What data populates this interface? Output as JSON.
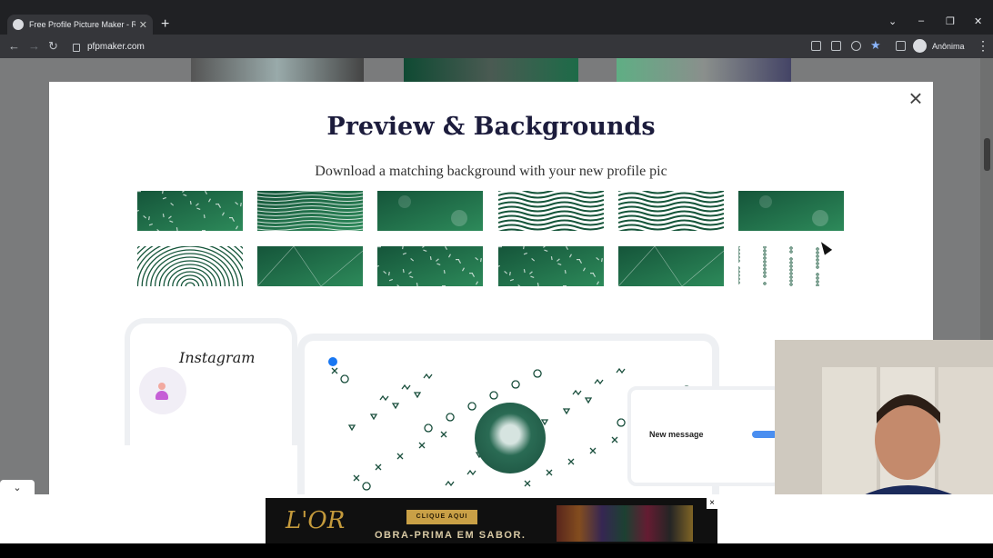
{
  "browser": {
    "tab_title": "Free Profile Picture Maker - Resu",
    "new_tab_symbol": "+",
    "url": "pfpmaker.com",
    "profile_label": "Anônima"
  },
  "modal": {
    "title": "Preview & Backgrounds",
    "subtitle": "Download a matching background with your new profile pic",
    "close_symbol": "×"
  },
  "backgrounds": [
    {
      "pattern": "confetti-lines"
    },
    {
      "pattern": "maze-swirl"
    },
    {
      "pattern": "gradient-shapes"
    },
    {
      "pattern": "star-rays"
    },
    {
      "pattern": "waves"
    },
    {
      "pattern": "bokeh-grid"
    },
    {
      "pattern": "concentric-rings"
    },
    {
      "pattern": "low-poly"
    },
    {
      "pattern": "wave-lines-shapes"
    },
    {
      "pattern": "doodle-shapes"
    },
    {
      "pattern": "dark-geometric"
    },
    {
      "pattern": "white-doodles"
    }
  ],
  "mockups": {
    "instagram_label": "Instagram",
    "message_title": "New message"
  },
  "ad": {
    "logo": "L'OR",
    "cta": "CLIQUE AQUI",
    "tagline": "OBRA-PRIMA EM SABOR.",
    "close_symbol": "×"
  },
  "colors": {
    "green_dark": "#15553a",
    "green_light": "#2d8a5a",
    "chrome_dark": "#202124",
    "chrome_toolbar": "#35363a",
    "title_color": "#1c1c3c"
  }
}
